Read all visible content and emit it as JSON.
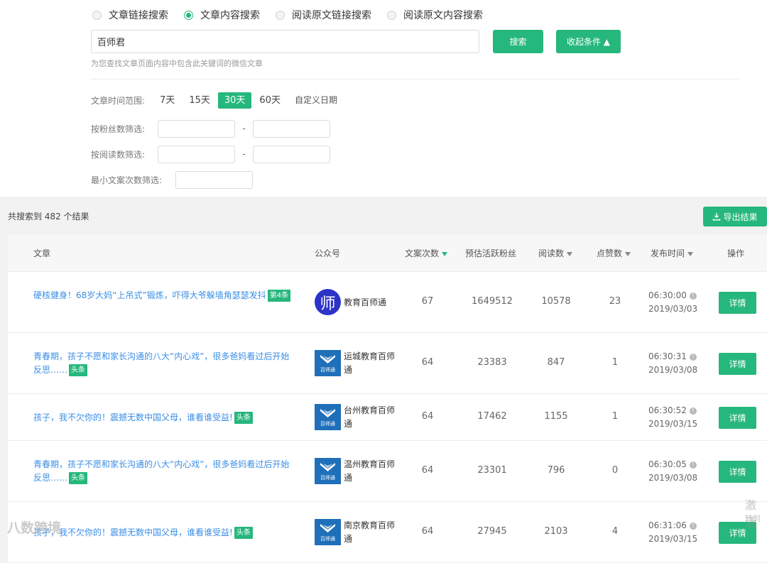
{
  "search_modes": [
    {
      "label": "文章链接搜索",
      "selected": false
    },
    {
      "label": "文章内容搜索",
      "selected": true
    },
    {
      "label": "阅读原文链接搜索",
      "selected": false
    },
    {
      "label": "阅读原文内容搜索",
      "selected": false
    }
  ],
  "search": {
    "value": "百师君",
    "button": "搜索",
    "collapse": "收起条件 ▲",
    "hint": "为您查找文章页面内容中包含此关键词的微信文章"
  },
  "filters": {
    "time_label": "文章时间范围:",
    "time_options": [
      "7天",
      "15天",
      "30天",
      "60天",
      "自定义日期"
    ],
    "time_selected": "30天",
    "fans_label": "按粉丝数筛选:",
    "reads_label": "按阅读数筛选:",
    "min_label": "最小文案次数筛选:",
    "dash": "-"
  },
  "results": {
    "count_text": "共搜索到 482 个结果",
    "export": "导出结果"
  },
  "table": {
    "headers": {
      "article": "文章",
      "account": "公众号",
      "copies": "文案次数",
      "fans": "预估活跃粉丝",
      "reads": "阅读数",
      "likes": "点赞数",
      "time": "发布时间",
      "ops": "操作"
    },
    "rows": [
      {
        "title": "硬核健身！68岁大妈“上吊式”锻炼，吓得大爷躲墙角瑟瑟发抖",
        "tag": "第4条",
        "account": "教育百师通",
        "logo": "circle",
        "logo_text": "师",
        "copies": "67",
        "fans": "1649512",
        "reads": "10578",
        "likes": "23",
        "time": "06:30:00",
        "date": "2019/03/03",
        "btn": "详情"
      },
      {
        "title": "青春期，孩子不愿和家长沟通的八大“内心戏”，很多爸妈看过后开始反思……",
        "tag": "头条",
        "account": "运城教育百师通",
        "logo": "book",
        "logo_text": "百师通",
        "copies": "64",
        "fans": "23383",
        "reads": "847",
        "likes": "1",
        "time": "06:30:31",
        "date": "2019/03/08",
        "btn": "详情"
      },
      {
        "title": "孩子，我不欠你的！震撼无数中国父母，谁看谁受益!",
        "tag": "头条",
        "account": "台州教育百师通",
        "logo": "book",
        "logo_text": "百师通",
        "copies": "64",
        "fans": "17462",
        "reads": "1155",
        "likes": "1",
        "time": "06:30:52",
        "date": "2019/03/15",
        "btn": "详情"
      },
      {
        "title": "青春期，孩子不愿和家长沟通的八大“内心戏”，很多爸妈看过后开始反思……",
        "tag": "头条",
        "account": "温州教育百师通",
        "logo": "book",
        "logo_text": "百师通",
        "copies": "64",
        "fans": "23301",
        "reads": "796",
        "likes": "0",
        "time": "06:30:05",
        "date": "2019/03/08",
        "btn": "详情"
      },
      {
        "title": "孩子，我不欠你的！震撼无数中国父母，谁看谁受益!",
        "tag": "头条",
        "account": "南京教育百师通",
        "logo": "book",
        "logo_text": "百师通",
        "copies": "64",
        "fans": "27945",
        "reads": "2103",
        "likes": "4",
        "time": "06:31:06",
        "date": "2019/03/15",
        "btn": "详情"
      }
    ]
  },
  "watermark": {
    "text": "八数跨境",
    "activate": "激活",
    "activate_sub": "转到"
  }
}
